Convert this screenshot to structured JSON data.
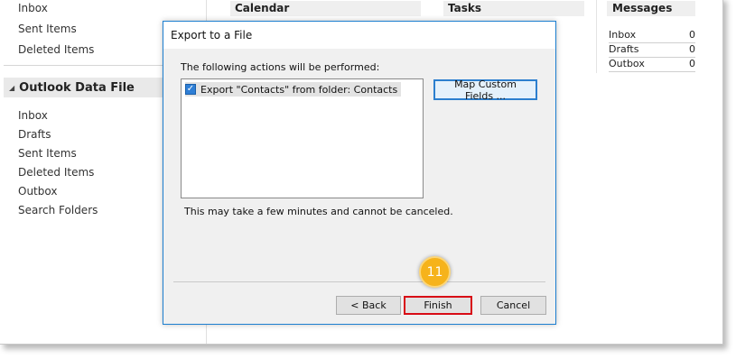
{
  "nav": {
    "top_items": [
      "Inbox",
      "Sent Items",
      "Deleted Items"
    ],
    "data_file_label": "Outlook Data File",
    "data_file_items": [
      "Inbox",
      "Drafts",
      "Sent Items",
      "Deleted Items",
      "Outbox",
      "Search Folders"
    ]
  },
  "panels": {
    "calendar": "Calendar",
    "tasks": "Tasks",
    "messages": {
      "title": "Messages",
      "rows": [
        {
          "label": "Inbox",
          "count": "0"
        },
        {
          "label": "Drafts",
          "count": "0"
        },
        {
          "label": "Outbox",
          "count": "0"
        }
      ]
    }
  },
  "dialog": {
    "title": "Export to a File",
    "actions_label": "The following actions will be performed:",
    "action_item": "Export \"Contacts\" from folder: Contacts",
    "action_checked": true,
    "map_button": "Map Custom Fields ...",
    "note": "This may take a few minutes and cannot be canceled.",
    "back_button": "< Back",
    "finish_button": "Finish",
    "cancel_button": "Cancel"
  },
  "callout": {
    "step": "11"
  },
  "colors": {
    "accent": "#2c7fcf",
    "highlight": "#d80b16",
    "callout": "#f6b31b"
  },
  "icons": {
    "expand": "triangle-down-icon",
    "checkbox": "checkmark-icon"
  }
}
